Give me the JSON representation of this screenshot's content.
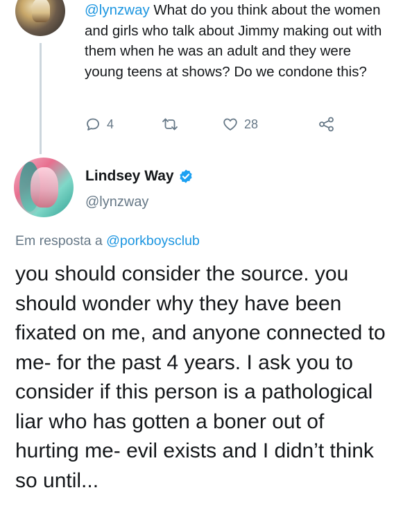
{
  "parent_tweet": {
    "mention": "@lynzway",
    "text": " What do you think about the women and girls who talk about Jimmy making out with them when he was an adult and they were young teens at shows? Do we condone this?",
    "actions": {
      "reply_count": "4",
      "like_count": "28"
    },
    "icons": {
      "reply": "speech-bubble-icon",
      "retweet": "retweet-icon",
      "like": "heart-icon",
      "share": "share-icon"
    }
  },
  "main_tweet": {
    "display_name": "Lindsey Way",
    "handle": "@lynzway",
    "verified_icon": "verified-badge-icon",
    "reply_context": {
      "prefix": "Em resposta a ",
      "mention": "@porkboysclub"
    },
    "text": "you should consider the source. you should wonder why they have been fixated on me, and anyone connected to me- for the past 4 years. I ask you to consider if this person is a pathological liar who has gotten a boner out of hurting me- evil exists and I didn’t think so until..."
  },
  "colors": {
    "text": "#14171a",
    "secondary": "#657786",
    "link": "#1b95e0",
    "verified": "#1da1f2",
    "thread_line": "#ccd6dd"
  }
}
